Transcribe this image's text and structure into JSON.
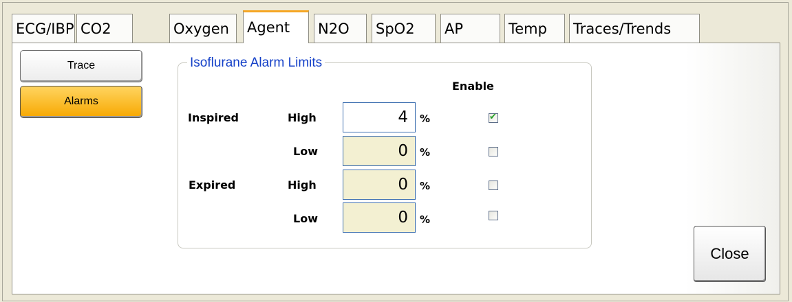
{
  "tabs": [
    {
      "label": "ECG/IBP"
    },
    {
      "label": "CO2"
    },
    {
      "label": "Oxygen"
    },
    {
      "label": "Agent",
      "active": true
    },
    {
      "label": "N2O"
    },
    {
      "label": "SpO2"
    },
    {
      "label": "AP"
    },
    {
      "label": "Temp"
    },
    {
      "label": "Traces/Trends"
    }
  ],
  "side": {
    "trace_label": "Trace",
    "alarms_label": "Alarms"
  },
  "group": {
    "title": "Isoflurane Alarm Limits",
    "enable_header": "Enable",
    "inspired_label": "Inspired",
    "expired_label": "Expired",
    "rows": [
      {
        "level": "High",
        "value": "4",
        "unit": "%",
        "enabled": true
      },
      {
        "level": "Low",
        "value": "0",
        "unit": "%",
        "enabled": false
      },
      {
        "level": "High",
        "value": "0",
        "unit": "%",
        "enabled": false
      },
      {
        "level": "Low",
        "value": "0",
        "unit": "%",
        "enabled": false
      }
    ]
  },
  "close_label": "Close",
  "colors": {
    "accent": "#f7a800",
    "group_title": "#1440c8",
    "field_bg": "#f3f0d2"
  }
}
